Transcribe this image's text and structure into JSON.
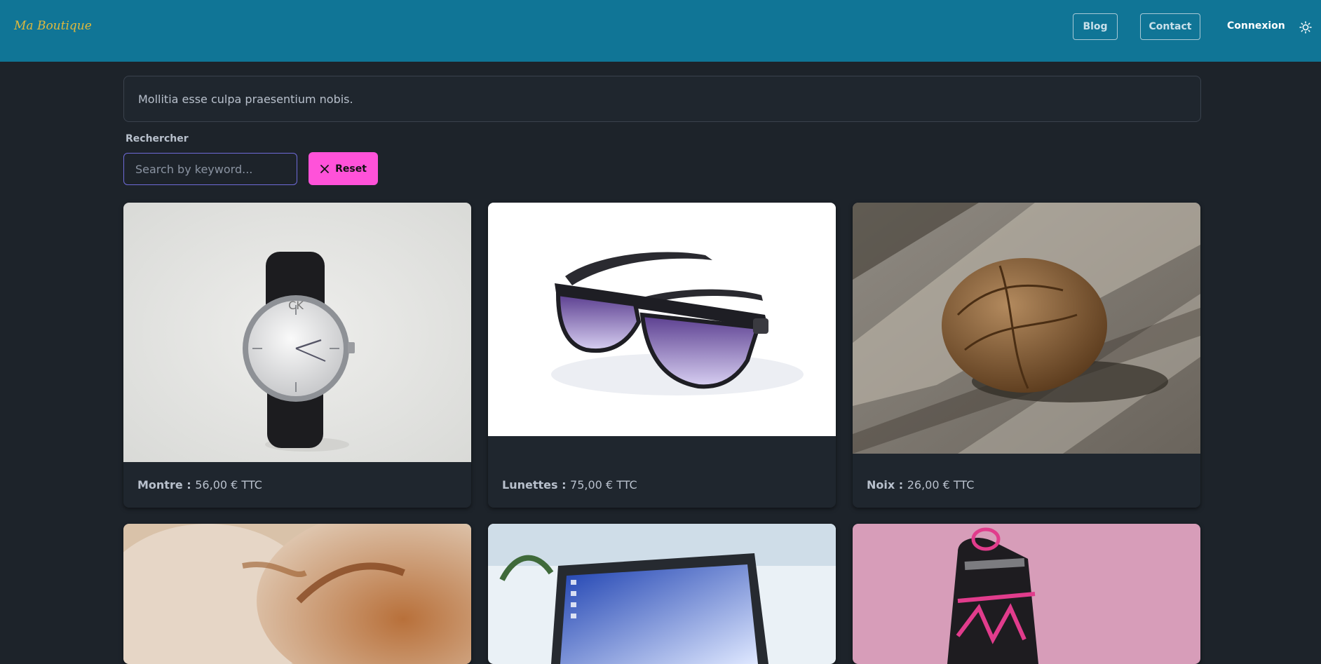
{
  "header": {
    "brand": "Ma Boutique",
    "nav": {
      "blog": "Blog",
      "contact": "Contact",
      "login": "Connexion"
    },
    "icons": {
      "theme_toggle": "sun-icon"
    }
  },
  "banner": {
    "text": "Mollitia esse culpa praesentium nobis."
  },
  "search": {
    "label": "Rechercher",
    "placeholder": "Search by keyword...",
    "value": "",
    "reset_label": "Reset"
  },
  "colors": {
    "navbar": "#107596",
    "background": "#1d232a",
    "accent": "#ff52d9",
    "brand": "#e0b93c"
  },
  "products": [
    {
      "name": "Montre",
      "sep": " : ",
      "price": "56,00 € TTC",
      "image": "wristwatch"
    },
    {
      "name": "Lunettes",
      "sep": " : ",
      "price": "75,00 € TTC",
      "image": "sunglasses"
    },
    {
      "name": "Noix",
      "sep": " : ",
      "price": "26,00 € TTC",
      "image": "walnut"
    },
    {
      "name": "",
      "sep": "",
      "price": "",
      "image": "bread"
    },
    {
      "name": "",
      "sep": "",
      "price": "",
      "image": "laptop"
    },
    {
      "name": "",
      "sep": "",
      "price": "",
      "image": "inline-skate"
    }
  ]
}
